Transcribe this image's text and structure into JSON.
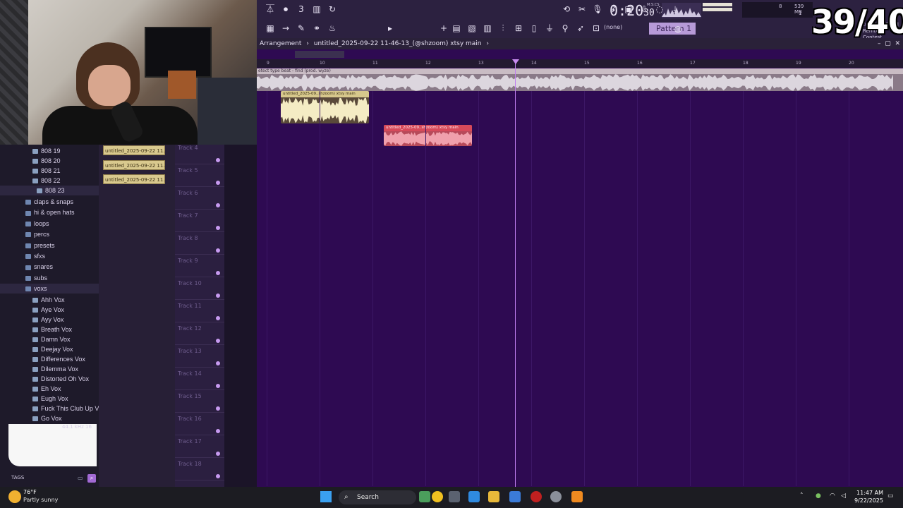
{
  "overlay": {
    "counter": "39/40"
  },
  "toolbar": {
    "time": "0:20",
    "time_frac": "30",
    "time_unit": "M:S:CS",
    "cpu_top": "8",
    "ram": "539 MB",
    "cpu_bottom": "1",
    "pattern_label": "Pattern 1",
    "snap_value": "(none)",
    "news_date": "08/27",
    "news_title": "DEDZII | Remix",
    "news_sub": "Contest"
  },
  "playlist": {
    "breadcrumb_root": "Arrangement",
    "breadcrumb_name": "untitled_2025-09-22 11-46-13_(@shzoom) xtsy main",
    "ruler_labels": [
      "9",
      "10",
      "11",
      "12",
      "13",
      "14",
      "15",
      "16",
      "17",
      "18",
      "19",
      "20"
    ],
    "audio_track_label": "etect type beat - find (prod. wyze)",
    "clip1_label": "untitled_2025-09..shzoom) xtsy main",
    "clip2_label": "untitled_2025-09..shzoom) xtsy main",
    "tracks": [
      "Track 4",
      "Track 5",
      "Track 6",
      "Track 7",
      "Track 8",
      "Track 9",
      "Track 10",
      "Track 11",
      "Track 12",
      "Track 13",
      "Track 14",
      "Track 15",
      "Track 16",
      "Track 17",
      "Track 18"
    ]
  },
  "channel_clips": [
    "untitled_2025-09-22 11...",
    "untitled_2025-09-22 11...",
    "untitled_2025-09-22 11..."
  ],
  "browser": {
    "items_808": [
      "808 19",
      "808 20",
      "808 21",
      "808 22",
      "808 23"
    ],
    "folders": [
      "claps & snaps",
      "hi & open hats",
      "loops",
      "percs",
      "presets",
      "sfxs",
      "snares",
      "subs",
      "voxs"
    ],
    "vox_files": [
      "Ahh Vox",
      "Aye Vox",
      "Ayy Vox",
      "Breath Vox",
      "Damn Vox",
      "Deejay Vox",
      "Differences Vox",
      "Dilemma Vox",
      "Distorted Oh Vox",
      "Eh Vox",
      "Eugh Vox",
      "Fuck This Club Up Vox",
      "Go Vox"
    ],
    "sample_rate": "44.1 kHz 16",
    "tags_label": "TAGS"
  },
  "taskbar": {
    "temp": "76°F",
    "weather": "Partly sunny",
    "search": "Search",
    "time": "11:47 AM",
    "date": "9/22/2025"
  }
}
